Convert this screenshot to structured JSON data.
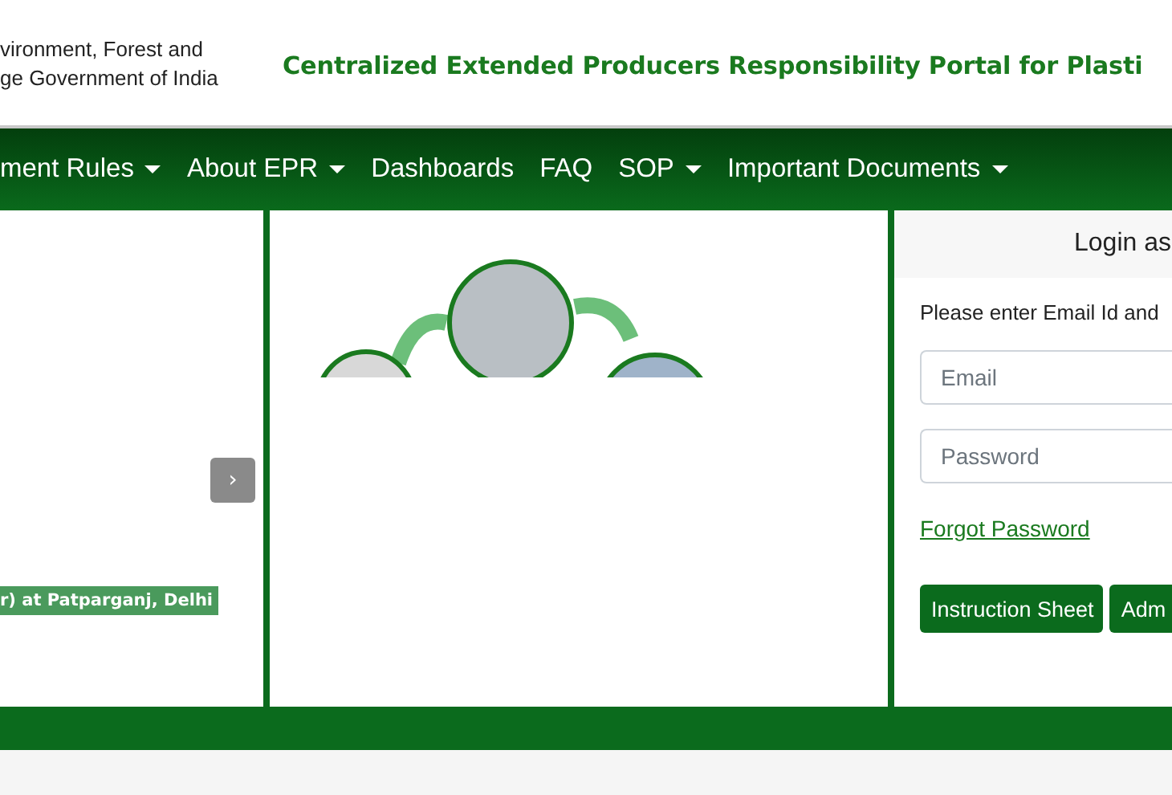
{
  "header": {
    "ministry_lines": [
      "vironment, Forest and",
      "ge Government of India"
    ],
    "title": "Centralized Extended Producers Responsibility Portal for Plasti"
  },
  "nav": {
    "items": [
      {
        "label": "ment Rules",
        "kind": "dropdown"
      },
      {
        "label": "About EPR",
        "kind": "dropdown"
      },
      {
        "label": "Dashboards",
        "kind": "link"
      },
      {
        "label": "FAQ",
        "kind": "link"
      },
      {
        "label": "SOP",
        "kind": "dropdown"
      },
      {
        "label": "Important Documents",
        "kind": "dropdown"
      }
    ]
  },
  "slider": {
    "caption": "r) at Patparganj, Delhi",
    "next_button": "›"
  },
  "login": {
    "heading": "Login as",
    "prompt": "Please enter Email Id and",
    "email": {
      "placeholder": "Email"
    },
    "password": {
      "placeholder": "Password"
    },
    "forgot_link": "Forgot Password",
    "buttons": [
      "Instruction Sheet",
      "Adm"
    ]
  }
}
